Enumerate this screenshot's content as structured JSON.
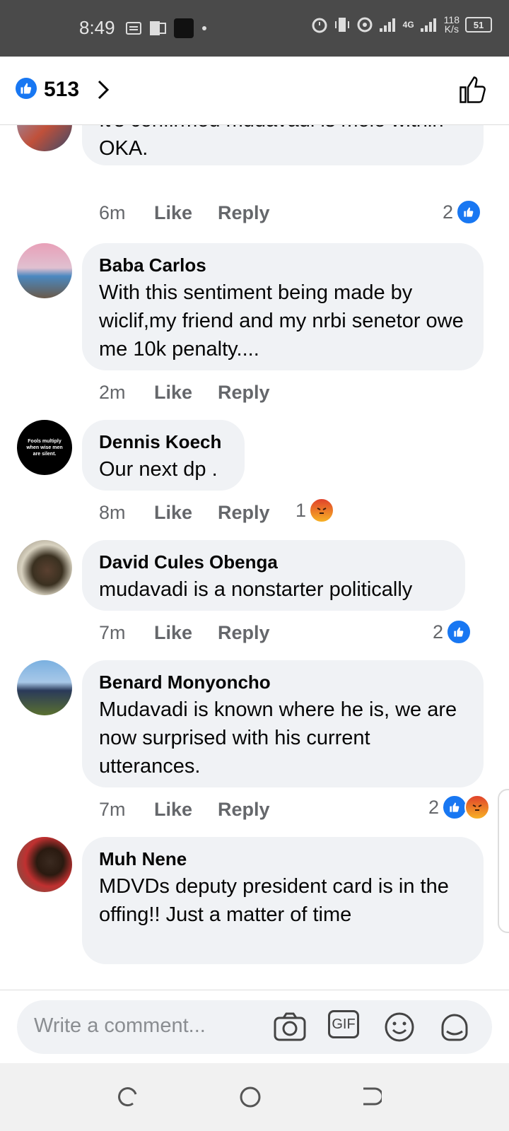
{
  "status_bar": {
    "time": "8:49",
    "network": "4G",
    "speed_value": "118",
    "speed_unit": "K/s",
    "battery": "51"
  },
  "header": {
    "like_count": "513"
  },
  "comments": [
    {
      "name": "",
      "text": "It's confirmed mudavadi is mole within OKA.",
      "time": "6m",
      "like_label": "Like",
      "reply_label": "Reply",
      "reaction_count": "2",
      "reactions": [
        "like"
      ]
    },
    {
      "name": "Baba Carlos",
      "text": "With this sentiment being made by wiclif,my friend and my nrbi senetor owe me 10k penalty....",
      "time": "2m",
      "like_label": "Like",
      "reply_label": "Reply",
      "reaction_count": "",
      "reactions": []
    },
    {
      "name": "Dennis Koech",
      "text": "Our next dp .",
      "time": "8m",
      "like_label": "Like",
      "reply_label": "Reply",
      "reaction_count": "1",
      "reactions": [
        "angry"
      ],
      "avatar_text": "Fools multiply when wise men are silent."
    },
    {
      "name": "David Cules Obenga",
      "text": "mudavadi is a nonstarter politically",
      "time": "7m",
      "like_label": "Like",
      "reply_label": "Reply",
      "reaction_count": "2",
      "reactions": [
        "like"
      ]
    },
    {
      "name": "Benard Monyoncho",
      "text": "Mudavadi is known where he is, we are now surprised with his current utterances.",
      "time": "7m",
      "like_label": "Like",
      "reply_label": "Reply",
      "reaction_count": "2",
      "reactions": [
        "like",
        "angry"
      ]
    },
    {
      "name": "Muh Nene",
      "text": "MDVDs deputy president card is in the offing!! Just a matter of time",
      "time": "",
      "like_label": "",
      "reply_label": "",
      "reaction_count": "",
      "reactions": []
    }
  ],
  "composer": {
    "placeholder": "Write a comment...",
    "gif_label": "GIF"
  },
  "colors": {
    "accent": "#1877f2",
    "bubble": "#f0f2f5",
    "secondary_text": "#65676b"
  }
}
